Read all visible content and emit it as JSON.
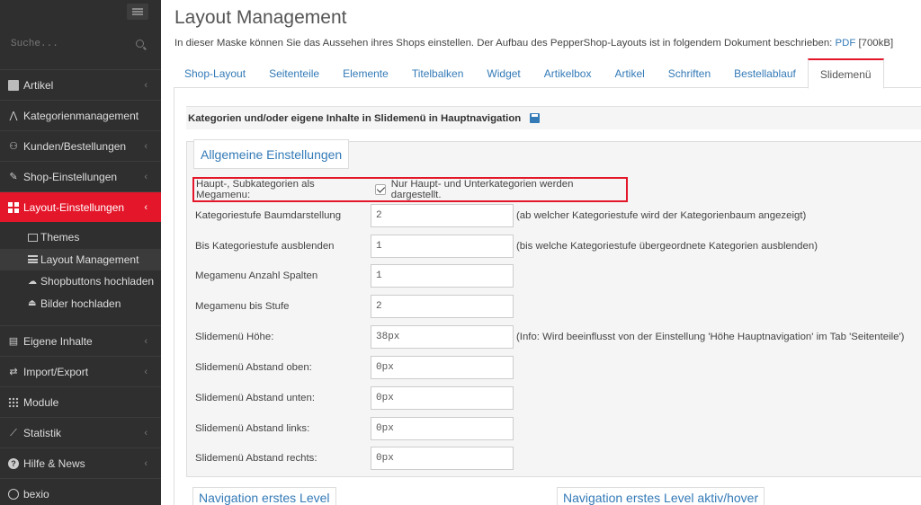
{
  "sidebar": {
    "search_placeholder": "Suche...",
    "items": [
      {
        "label": "Artikel",
        "icon": "box-icon"
      },
      {
        "label": "Kategorienmanagement",
        "icon": "tree-icon"
      },
      {
        "label": "Kunden/Bestellungen",
        "icon": "users-icon"
      },
      {
        "label": "Shop-Einstellungen",
        "icon": "wrench-icon"
      },
      {
        "label": "Layout-Einstellungen",
        "icon": "grid-icon"
      },
      {
        "label": "Eigene Inhalte",
        "icon": "file-icon"
      },
      {
        "label": "Import/Export",
        "icon": "exchange-icon"
      },
      {
        "label": "Module",
        "icon": "modules-icon"
      },
      {
        "label": "Statistik",
        "icon": "chart-icon"
      },
      {
        "label": "Hilfe & News",
        "icon": "help-icon"
      },
      {
        "label": "bexio",
        "icon": "circle-icon"
      }
    ],
    "subitems": [
      {
        "label": "Themes",
        "icon": "image-icon"
      },
      {
        "label": "Layout Management",
        "icon": "list-icon"
      },
      {
        "label": "Shopbuttons hochladen",
        "icon": "cloud-icon"
      },
      {
        "label": "Bilder hochladen",
        "icon": "upload-icon"
      }
    ]
  },
  "main": {
    "title": "Layout Management",
    "intro_text": "In dieser Maske können Sie das Aussehen ihres Shops einstellen. Der Aufbau des PepperShop-Layouts ist in folgendem Dokument beschrieben: ",
    "intro_link": "PDF",
    "intro_size": " [700kB]",
    "tabs": [
      "Shop-Layout",
      "Seitenteile",
      "Elemente",
      "Titelbalken",
      "Widget",
      "Artikelbox",
      "Artikel",
      "Schriften",
      "Bestellablauf",
      "Slidemenü"
    ],
    "section_title": "Kategorien und/oder eigene Inhalte in Slidemenü in Hauptnavigation",
    "fieldset_title": "Allgemeine Einstellungen",
    "megamenu_label": "Haupt-, Subkategorien als Megamenu:",
    "megamenu_checkbox_text": "Nur Haupt- und Unterkategorien werden dargestellt.",
    "fields": [
      {
        "label": "Kategoriestufe Baumdarstellung",
        "value": "2",
        "hint": "(ab welcher Kategoriestufe wird der Kategorienbaum angezeigt)"
      },
      {
        "label": "Bis Kategoriestufe ausblenden",
        "value": "1",
        "hint": "(bis welche Kategoriestufe übergeordnete Kategorien ausblenden)"
      },
      {
        "label": "Megamenu Anzahl Spalten",
        "value": "1",
        "hint": ""
      },
      {
        "label": "Megamenu bis Stufe",
        "value": "2",
        "hint": ""
      },
      {
        "label": "Slidemenü Höhe:",
        "value": "38px",
        "hint": "(Info: Wird beeinflusst von der Einstellung 'Höhe Hauptnavigation' im Tab 'Seitenteile')"
      },
      {
        "label": "Slidemenü Abstand oben:",
        "value": "0px",
        "hint": ""
      },
      {
        "label": "Slidemenü Abstand unten:",
        "value": "0px",
        "hint": ""
      },
      {
        "label": "Slidemenü Abstand links:",
        "value": "0px",
        "hint": ""
      },
      {
        "label": "Slidemenü Abstand rechts:",
        "value": "0px",
        "hint": ""
      }
    ],
    "bottom_legends": [
      "Navigation erstes Level",
      "Navigation erstes Level aktiv/hover"
    ]
  },
  "colors": {
    "accent": "#e4172a",
    "link": "#337ab7",
    "sidebar_bg": "#2f2f2f"
  }
}
